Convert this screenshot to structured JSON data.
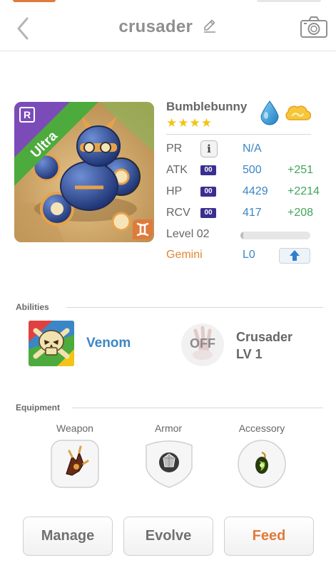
{
  "header": {
    "title": "crusader",
    "back_icon": "chevron-left-icon",
    "edit_icon": "pencil-icon",
    "camera_icon": "camera-icon"
  },
  "monster": {
    "name": "Bumblebunny",
    "stars": "★★★★",
    "star_count": 4,
    "rarity_badge": "Ultra",
    "class_icon": "R",
    "sign_icon": "gemini-symbol-icon",
    "element_icons": [
      "water-drop-icon",
      "cloud-icon"
    ]
  },
  "stats": {
    "pr": {
      "label": "PR",
      "info": "i",
      "value": "N/A"
    },
    "atk": {
      "label": "ATK",
      "badge": "00",
      "value": "500",
      "bonus": "+251"
    },
    "hp": {
      "label": "HP",
      "badge": "00",
      "value": "4429",
      "bonus": "+2214"
    },
    "rcv": {
      "label": "RCV",
      "badge": "00",
      "value": "417",
      "bonus": "+208"
    },
    "level": {
      "label": "Level 02",
      "progress": 0.02
    },
    "sign": {
      "label": "Gemini",
      "value": "L0",
      "upgrade_icon": "arrow-up-icon"
    }
  },
  "abilities": {
    "title": "Abilities",
    "active": {
      "name": "Venom",
      "icon": "skull-icon"
    },
    "leader": {
      "status": "OFF",
      "name_line1": "Crusader",
      "name_line2": "LV 1"
    }
  },
  "equipment": {
    "title": "Equipment",
    "slots": [
      {
        "label": "Weapon",
        "icon": "claw-weapon-icon"
      },
      {
        "label": "Armor",
        "icon": "crystal-armor-icon"
      },
      {
        "label": "Accessory",
        "icon": "green-gem-icon"
      }
    ]
  },
  "actions": {
    "manage": "Manage",
    "evolve": "Evolve",
    "feed": "Feed"
  },
  "colors": {
    "accent_orange": "#e07a3a",
    "stat_blue": "#3b86c6",
    "bonus_green": "#3fa65b",
    "star_yellow": "#f2c418",
    "badge_purple": "#3a2f91",
    "ultra_green": "#4daa3c"
  }
}
